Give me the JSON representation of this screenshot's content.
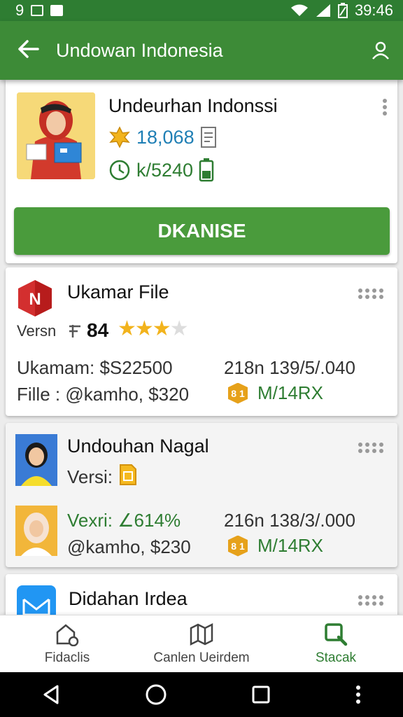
{
  "status_bar": {
    "left_text": "9",
    "time": "39:46"
  },
  "app_bar": {
    "title": "Undowan Indonesia",
    "back_icon": "arrow-left-icon",
    "profile_icon": "user-icon"
  },
  "featured": {
    "title": "Undeurhan Indonssi",
    "downloads": "18,068",
    "size": "k/5240",
    "button_label": "DKANISE"
  },
  "items": [
    {
      "title": "Ukamar File",
      "version_label": "Versn",
      "rating_value": "84",
      "rating_stars": 3,
      "rating_max": 5,
      "line1": "Ukamam: $S22500",
      "line2": "Fille : @kamho, $320",
      "stat": "218n 139/5/.040",
      "badge": "8 1",
      "badge_text": "M/14RX"
    },
    {
      "title": "Undouhan Nagal",
      "version_label": "Versi:",
      "line1": "Vexri: ∠614%",
      "line2": "@kamho, $230",
      "stat": "216n 138/3/.000",
      "badge": "8 1",
      "badge_text": "M/14RX"
    },
    {
      "title": "Didahan Irdea"
    }
  ],
  "bottom_nav": [
    {
      "label": "Fidaclis",
      "icon": "home-settings-icon"
    },
    {
      "label": "Canlen Ueirdem",
      "icon": "map-icon"
    },
    {
      "label": "Stacak",
      "icon": "search-icon",
      "active": true
    }
  ],
  "colors": {
    "primary": "#3d8b37",
    "status_bar": "#2e7d32",
    "accent_blue": "#1f7fb5",
    "star": "#f2b31c"
  }
}
